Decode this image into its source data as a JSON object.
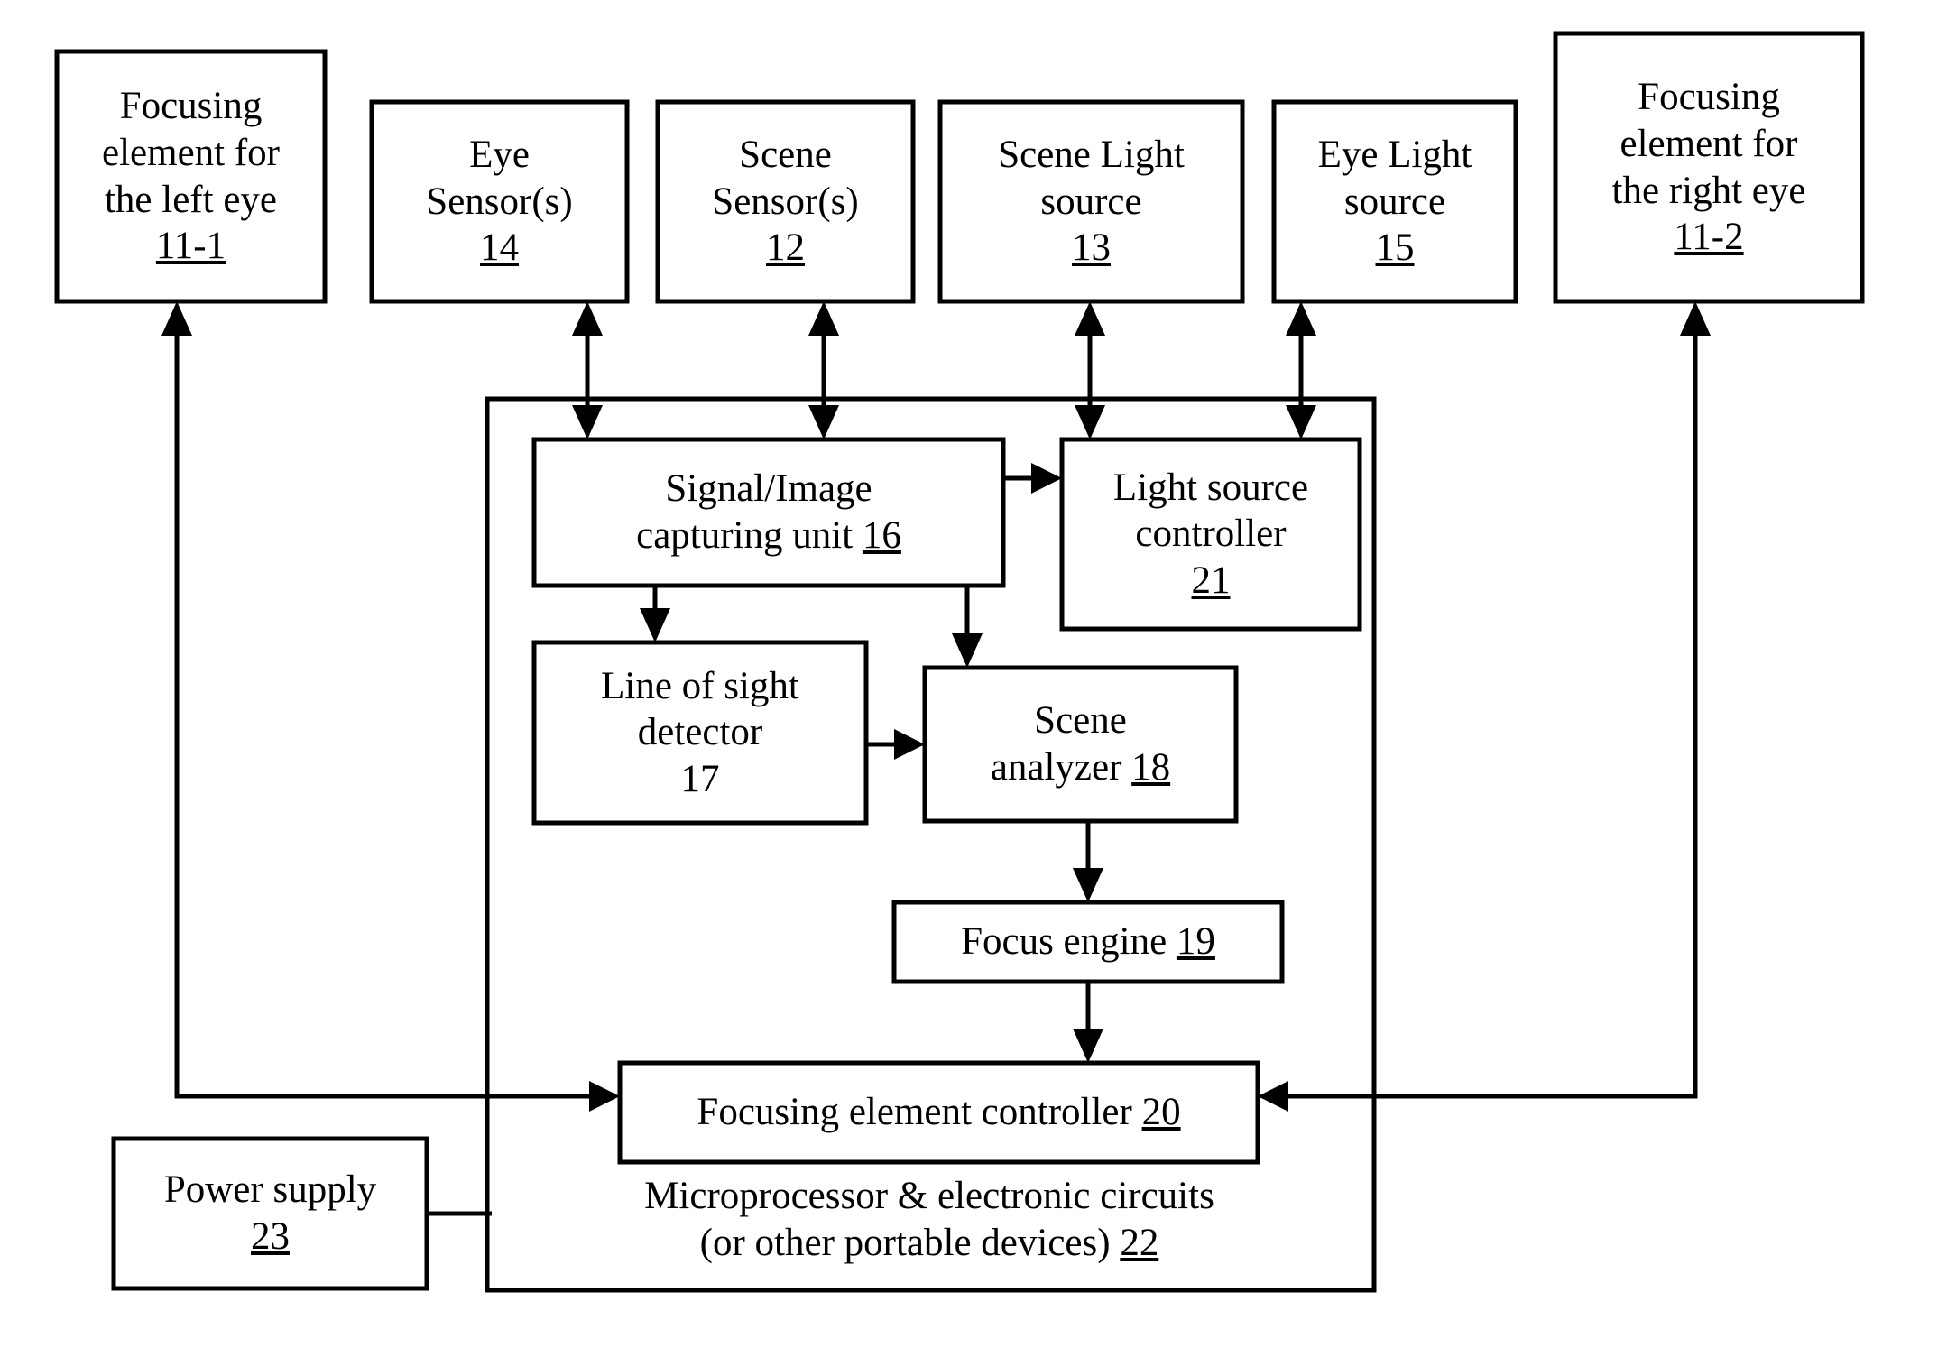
{
  "figure": {
    "type": "block-diagram",
    "title": "Eye/scene focusing system block diagram",
    "line_color": "#000000",
    "background": "#ffffff"
  },
  "boxes": {
    "focusing_left": {
      "line1": "Focusing",
      "line2": "element for",
      "line3": "the left eye",
      "ref": "11-1"
    },
    "eye_sensors": {
      "line1": "Eye",
      "line2": "Sensor(s)",
      "ref": "14"
    },
    "scene_sensors": {
      "line1": "Scene",
      "line2": "Sensor(s)",
      "ref": "12"
    },
    "scene_light_source": {
      "line1": "Scene Light",
      "line2": "source",
      "ref": "13"
    },
    "eye_light_source": {
      "line1": "Eye Light",
      "line2": "source",
      "ref": "15"
    },
    "focusing_right": {
      "line1": "Focusing",
      "line2": "element for",
      "line3": "the right eye",
      "ref": "11-2"
    },
    "signal_image_capturing": {
      "line1": "Signal/Image",
      "line2": "capturing unit",
      "ref": "16"
    },
    "light_source_controller": {
      "line1": "Light source",
      "line2": "controller",
      "ref": "21"
    },
    "line_of_sight_detector": {
      "line1": "Line of sight",
      "line2": "detector",
      "ref": "17"
    },
    "scene_analyzer": {
      "line1": "Scene",
      "line2": "analyzer",
      "ref": "18"
    },
    "focus_engine": {
      "line1": "Focus engine",
      "ref": "19"
    },
    "focusing_element_controller": {
      "line1": "Focusing element controller",
      "ref": "20"
    },
    "power_supply": {
      "line1": "Power supply",
      "ref": "23"
    },
    "microprocessor_enclosure": {
      "line1": "Microprocessor & electronic circuits",
      "line2": "(or other portable devices)",
      "ref": "22"
    }
  },
  "connections": [
    {
      "from": "eye_sensors",
      "to": "signal_image_capturing",
      "kind": "double-arrow-vertical"
    },
    {
      "from": "scene_sensors",
      "to": "signal_image_capturing",
      "kind": "double-arrow-vertical"
    },
    {
      "from": "scene_light_source",
      "to": "light_source_controller",
      "kind": "double-arrow-vertical"
    },
    {
      "from": "eye_light_source",
      "to": "light_source_controller",
      "kind": "double-arrow-vertical"
    },
    {
      "from": "signal_image_capturing",
      "to": "light_source_controller",
      "kind": "arrow-right"
    },
    {
      "from": "signal_image_capturing",
      "to": "line_of_sight_detector",
      "kind": "arrow-down"
    },
    {
      "from": "signal_image_capturing",
      "to": "scene_analyzer",
      "kind": "arrow-down"
    },
    {
      "from": "line_of_sight_detector",
      "to": "scene_analyzer",
      "kind": "arrow-right"
    },
    {
      "from": "scene_analyzer",
      "to": "focus_engine",
      "kind": "arrow-down"
    },
    {
      "from": "focus_engine",
      "to": "focusing_element_controller",
      "kind": "arrow-down"
    },
    {
      "from": "focusing_element_controller",
      "to": "focusing_left",
      "kind": "arrow-up-left-path"
    },
    {
      "from": "focusing_element_controller",
      "to": "focusing_right",
      "kind": "arrow-up-right-path"
    },
    {
      "from": "power_supply",
      "to": "microprocessor_enclosure",
      "kind": "line-right"
    }
  ]
}
